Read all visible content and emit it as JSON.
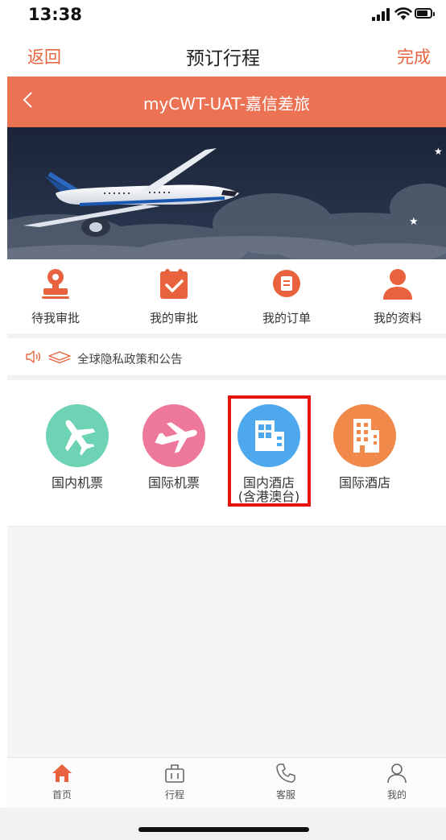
{
  "status": {
    "time": "13:38"
  },
  "nav": {
    "back": "返回",
    "title": "预订行程",
    "done": "完成"
  },
  "header": {
    "title": "myCWT-UAT-嘉信差旅"
  },
  "quick_menu": [
    {
      "label": "待我审批",
      "icon": "pending-approval-icon"
    },
    {
      "label": "我的审批",
      "icon": "calendar-check-icon"
    },
    {
      "label": "我的订单",
      "icon": "order-document-icon"
    },
    {
      "label": "我的资料",
      "icon": "profile-person-icon"
    }
  ],
  "notice": {
    "text": "全球隐私政策和公告"
  },
  "services": [
    {
      "label": "国内机票",
      "sublabel": "",
      "color": "#6dd3b4",
      "icon": "domestic-flight-icon"
    },
    {
      "label": "国际机票",
      "sublabel": "",
      "color": "#ee789a",
      "icon": "international-flight-icon"
    },
    {
      "label": "国内酒店",
      "sublabel": "(含港澳台)",
      "color": "#4ea8ee",
      "icon": "domestic-hotel-icon"
    },
    {
      "label": "国际酒店",
      "sublabel": "",
      "color": "#f0894a",
      "icon": "international-hotel-icon"
    }
  ],
  "tabs": [
    {
      "label": "首页",
      "icon": "home-icon"
    },
    {
      "label": "行程",
      "icon": "itinerary-icon"
    },
    {
      "label": "客服",
      "icon": "phone-icon"
    },
    {
      "label": "我的",
      "icon": "user-icon"
    }
  ],
  "colors": {
    "accent": "#ec7254",
    "nav_text": "#e8643e",
    "highlight": "#e8130d"
  }
}
